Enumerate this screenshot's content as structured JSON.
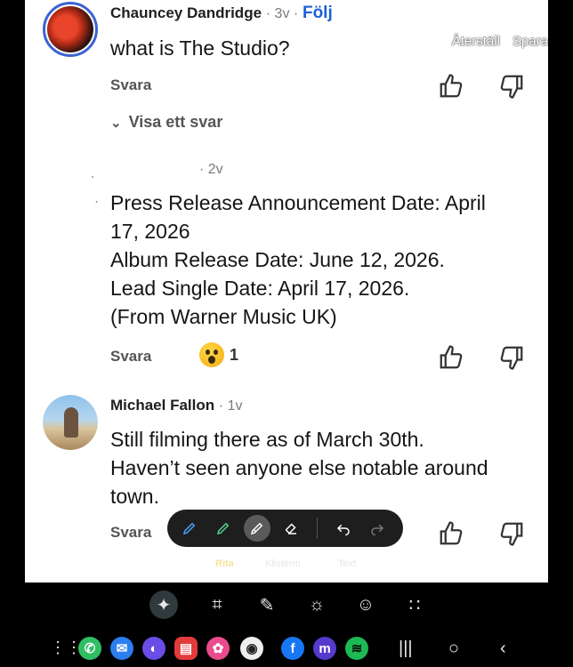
{
  "comments": [
    {
      "author": "Chauncey Dandridge",
      "meta": "· 3v ·",
      "follow": "Följ",
      "text": "what is The Studio?",
      "reply": "Svara",
      "view_replies": "Visa ett svar"
    },
    {
      "author": "",
      "meta": "· 2v",
      "lines": [
        "Press Release Announcement Date: April",
        "17, 2026",
        "Album Release Date: June 12, 2026.",
        "Lead Single Date: April 17, 2026.",
        "(From Warner Music UK)"
      ],
      "reply": "Svara",
      "reaction_count": "1"
    },
    {
      "author": "Michael Fallon",
      "meta": "· 1v",
      "lines": [
        "Still filming there as of March 30th.",
        "Haven’t seen anyone else notable around",
        "town."
      ],
      "reply": "Svara"
    }
  ],
  "overlay_actions": {
    "reset": "Återställ",
    "save": "Spara"
  },
  "draw_modes": {
    "draw": "Rita",
    "sticker": "Klisterm",
    "text": "Text"
  },
  "colors": {
    "follow": "#1d5fd6",
    "avatar_ring": "#3b63d4",
    "toolbar_bg": "#1e1e1e"
  }
}
